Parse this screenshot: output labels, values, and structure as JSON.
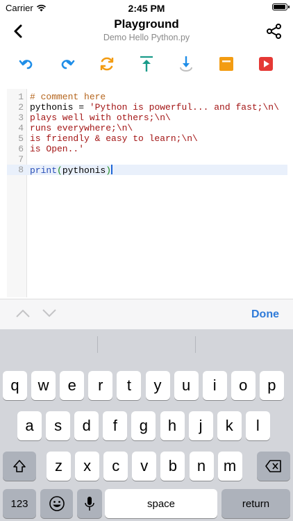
{
  "status": {
    "carrier": "Carrier",
    "time": "2:45 PM",
    "battery_level": 1.0
  },
  "nav": {
    "title": "Playground",
    "subtitle": "Demo Hello Python.py",
    "back_icon": "chevron-left-icon",
    "share_icon": "share-icon"
  },
  "toolbar": {
    "icons": [
      "undo-icon",
      "redo-icon",
      "refresh-icon",
      "move-to-top-icon",
      "move-down-icon",
      "stop-icon",
      "run-icon"
    ],
    "colors": {
      "blue": "#1f8ee8",
      "orange": "#f39c12",
      "red": "#e53935"
    }
  },
  "editor": {
    "lines": [
      {
        "num": "1",
        "parts": [
          {
            "t": "# comment here",
            "c": "comment"
          }
        ]
      },
      {
        "num": "2",
        "parts": [
          {
            "t": "pythonis = ",
            "c": "plain"
          },
          {
            "t": "'Python is powerful... and fast;\\n\\",
            "c": "str"
          }
        ]
      },
      {
        "num": "3",
        "parts": [
          {
            "t": "plays well with others;\\n\\",
            "c": "str"
          }
        ]
      },
      {
        "num": "4",
        "parts": [
          {
            "t": "runs everywhere;\\n\\",
            "c": "str"
          }
        ]
      },
      {
        "num": "5",
        "parts": [
          {
            "t": "is friendly & easy to learn;\\n\\",
            "c": "str"
          }
        ]
      },
      {
        "num": "6",
        "parts": [
          {
            "t": "is Open..'",
            "c": "str"
          }
        ]
      },
      {
        "num": "7",
        "parts": []
      },
      {
        "num": "8",
        "active": true,
        "parts": [
          {
            "t": "print",
            "c": "kw"
          },
          {
            "t": "(",
            "c": "paren"
          },
          {
            "t": "pythonis",
            "c": "plain"
          },
          {
            "t": ")",
            "c": "paren"
          }
        ]
      }
    ]
  },
  "accessory": {
    "done_label": "Done",
    "prev_icon": "chevron-up-icon",
    "next_icon": "chevron-down-icon"
  },
  "keyboard": {
    "row1": [
      "q",
      "w",
      "e",
      "r",
      "t",
      "y",
      "u",
      "i",
      "o",
      "p"
    ],
    "row2": [
      "a",
      "s",
      "d",
      "f",
      "g",
      "h",
      "j",
      "k",
      "l"
    ],
    "row3": [
      "z",
      "x",
      "c",
      "v",
      "b",
      "n",
      "m"
    ],
    "shift_icon": "shift-icon",
    "delete_icon": "delete-icon",
    "numbers_label": "123",
    "emoji_icon": "emoji-icon",
    "mic_icon": "microphone-icon",
    "space_label": "space",
    "return_label": "return"
  }
}
